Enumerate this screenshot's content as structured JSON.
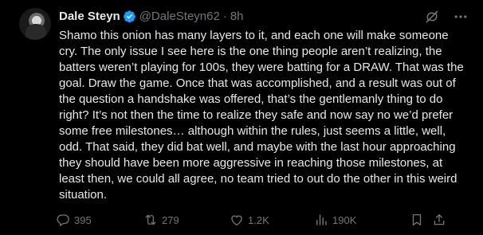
{
  "author": {
    "name": "Dale Steyn",
    "handle": "@DaleSteyn62",
    "separator": "·",
    "time": "8h",
    "verified_color": "#1d9bf0"
  },
  "tweet_text": "Shamo this onion has many layers to it, and each one will make someone cry. The only issue I see  here is the one thing people aren’t realizing, the batters weren’t playing for 100s, they were batting for a DRAW. That was the goal. Draw the game. Once that was accomplished, and a result was out of the question a handshake was offered, that’s the gentlemanly thing to do right? It’s not then the time to realize they safe and now say no we’d prefer some free milestones… although within the rules, just seems a little, well, odd. That said, they did bat well, and maybe with the last hour approaching they should have been more aggressive in reaching those milestones, at least then, we could all agree, no team tried to out do the other in this weird situation.",
  "metrics": {
    "replies": "395",
    "reposts": "279",
    "likes": "1.2K",
    "views": "190K"
  },
  "icons": {
    "grok": "grok-icon",
    "more": "more-icon",
    "reply": "reply-icon",
    "repost": "repost-icon",
    "like": "heart-icon",
    "views": "views-icon",
    "bookmark": "bookmark-icon",
    "share": "share-icon"
  },
  "colors": {
    "background": "#000000",
    "text": "#e7e9ea",
    "muted": "#71767b",
    "accent": "#1d9bf0"
  }
}
